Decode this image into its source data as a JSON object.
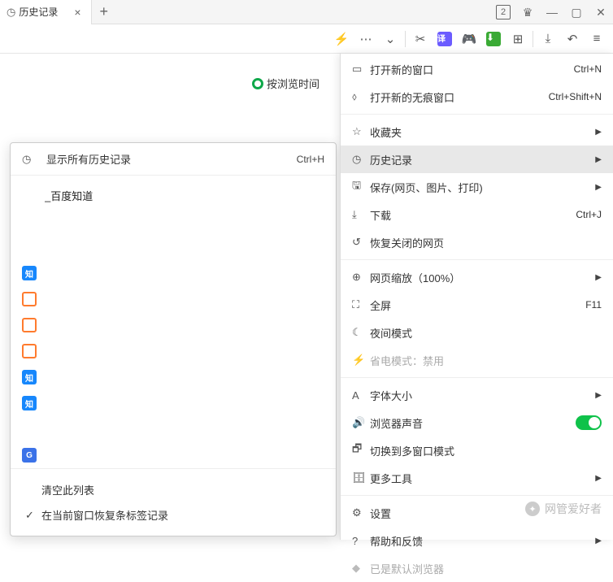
{
  "titlebar": {
    "tab_title": "历史记录",
    "tab_count": "2"
  },
  "sort_indicator": {
    "label": "按浏览时间"
  },
  "history_submenu": {
    "header_label": "显示所有历史记录",
    "header_shortcut": "Ctrl+H",
    "items": [
      {
        "favicon": "baidu",
        "title": "_百度知道"
      },
      {
        "favicon": "baidu",
        "title": ""
      },
      {
        "favicon": "baidu",
        "title": ""
      },
      {
        "favicon": "zhihu",
        "title": ""
      },
      {
        "favicon": "sogou",
        "title": ""
      },
      {
        "favicon": "sogou",
        "title": ""
      },
      {
        "favicon": "sogou",
        "title": ""
      },
      {
        "favicon": "zhihu",
        "title": ""
      },
      {
        "favicon": "zhihu",
        "title": ""
      },
      {
        "favicon": "baidu",
        "title": ""
      },
      {
        "favicon": "generic",
        "title": ""
      },
      {
        "favicon": "sogou",
        "title": ""
      }
    ],
    "footer_clear": "清空此列表",
    "footer_restore": "在当前窗口恢复条标签记录"
  },
  "main_menu": {
    "items": [
      {
        "icon": "window-icon",
        "label": "打开新的窗口",
        "shortcut": "Ctrl+N"
      },
      {
        "icon": "incognito-icon",
        "label": "打开新的无痕窗口",
        "shortcut": "Ctrl+Shift+N"
      },
      {
        "sep": true
      },
      {
        "icon": "star-icon",
        "label": "收藏夹",
        "arrow": true
      },
      {
        "icon": "clock-icon",
        "label": "历史记录",
        "arrow": true,
        "highlight": true
      },
      {
        "icon": "save-icon",
        "label": "保存(网页、图片、打印)",
        "arrow": true
      },
      {
        "icon": "download-icon",
        "label": "下载",
        "shortcut": "Ctrl+J"
      },
      {
        "icon": "restore-icon",
        "label": "恢复关闭的网页"
      },
      {
        "sep": true
      },
      {
        "icon": "zoom-icon",
        "label": "网页缩放（100%）",
        "arrow": true
      },
      {
        "icon": "fullscreen-icon",
        "label": "全屏",
        "shortcut": "F11"
      },
      {
        "icon": "moon-icon",
        "label": "夜间模式"
      },
      {
        "icon": "plug-icon",
        "label": "省电模式：禁用",
        "disabled": true
      },
      {
        "sep": true
      },
      {
        "icon": "font-icon",
        "label": "字体大小",
        "arrow": true
      },
      {
        "icon": "sound-icon",
        "label": "浏览器声音",
        "toggle": true
      },
      {
        "icon": "multiwindow-icon",
        "label": "切换到多窗口模式"
      },
      {
        "icon": "tools-icon",
        "label": "更多工具",
        "arrow": true
      },
      {
        "sep": true
      },
      {
        "icon": "settings-icon",
        "label": "设置"
      },
      {
        "icon": "help-icon",
        "label": "帮助和反馈",
        "arrow": true
      },
      {
        "icon": "default-browser-icon",
        "label": "已是默认浏览器",
        "disabled": true
      }
    ]
  },
  "watermark": {
    "text": "网管爱好者"
  }
}
